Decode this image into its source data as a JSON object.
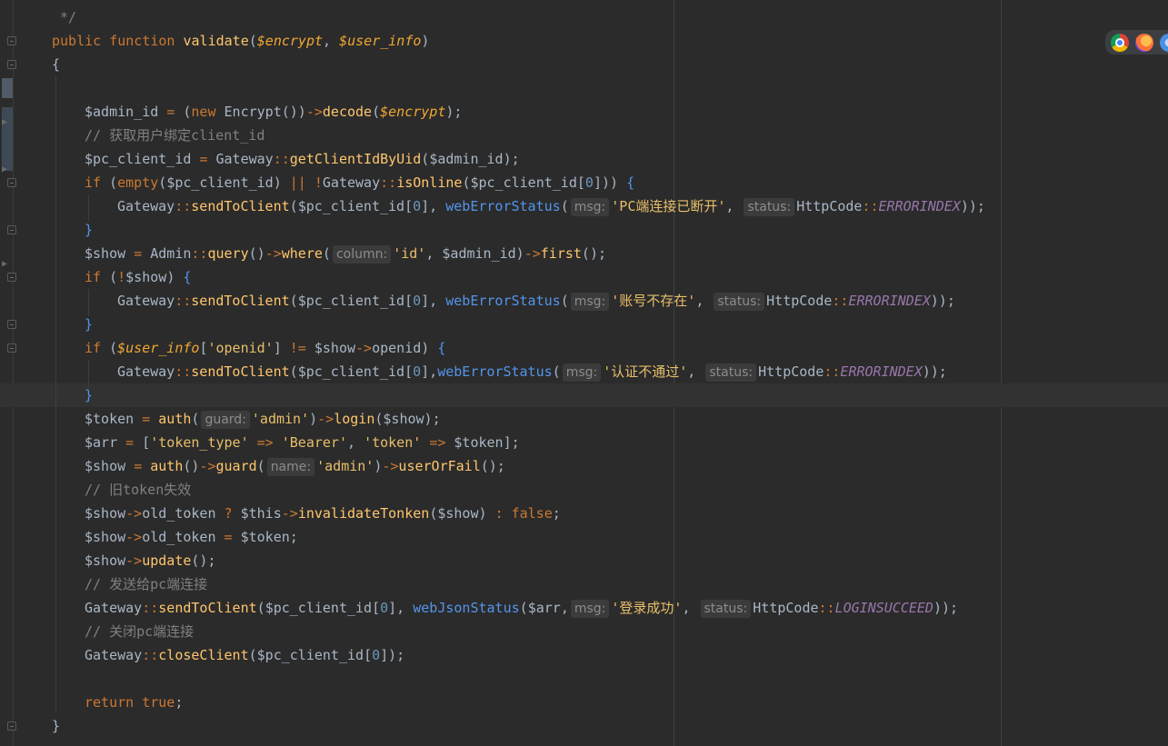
{
  "editor": {
    "lines": [
      {
        "segments": [
          {
            "t": " */",
            "c": "cm"
          }
        ]
      },
      {
        "segments": [
          {
            "t": "public ",
            "c": "kw"
          },
          {
            "t": "function ",
            "c": "kw"
          },
          {
            "t": "validate",
            "c": "fn"
          },
          {
            "t": "(",
            "c": "br"
          },
          {
            "t": "$encrypt",
            "c": "param"
          },
          {
            "t": ", ",
            "c": "br"
          },
          {
            "t": "$user_info",
            "c": "param"
          },
          {
            "t": ")",
            "c": "br"
          }
        ]
      },
      {
        "segments": [
          {
            "t": "{",
            "c": "br"
          }
        ]
      },
      {
        "segments": []
      },
      {
        "segments": [
          {
            "t": "$admin_id ",
            "c": "var"
          },
          {
            "t": "= ",
            "c": "op"
          },
          {
            "t": "(",
            "c": "br"
          },
          {
            "t": "new ",
            "c": "kw"
          },
          {
            "t": "Encrypt",
            "c": "var"
          },
          {
            "t": "())",
            "c": "br"
          },
          {
            "t": "->",
            "c": "op"
          },
          {
            "t": "decode",
            "c": "mcall"
          },
          {
            "t": "(",
            "c": "br"
          },
          {
            "t": "$encrypt",
            "c": "param"
          },
          {
            "t": ");",
            "c": "br"
          }
        ]
      },
      {
        "segments": [
          {
            "t": "// 获取用户绑定client_id",
            "c": "cm"
          }
        ]
      },
      {
        "segments": [
          {
            "t": "$pc_client_id ",
            "c": "var"
          },
          {
            "t": "= ",
            "c": "op"
          },
          {
            "t": "Gateway",
            "c": "var"
          },
          {
            "t": "::",
            "c": "op"
          },
          {
            "t": "getClientIdByUid",
            "c": "mcall"
          },
          {
            "t": "(",
            "c": "br"
          },
          {
            "t": "$admin_id",
            "c": "var"
          },
          {
            "t": ");",
            "c": "br"
          }
        ]
      },
      {
        "segments": [
          {
            "t": "if ",
            "c": "kw"
          },
          {
            "t": "(",
            "c": "br"
          },
          {
            "t": "empty",
            "c": "kw"
          },
          {
            "t": "(",
            "c": "br"
          },
          {
            "t": "$pc_client_id",
            "c": "var"
          },
          {
            "t": ") ",
            "c": "br"
          },
          {
            "t": "|| ",
            "c": "op"
          },
          {
            "t": "!",
            "c": "op"
          },
          {
            "t": "Gateway",
            "c": "var"
          },
          {
            "t": "::",
            "c": "op"
          },
          {
            "t": "isOnline",
            "c": "mcall"
          },
          {
            "t": "(",
            "c": "br"
          },
          {
            "t": "$pc_client_id",
            "c": "var"
          },
          {
            "t": "[",
            "c": "br"
          },
          {
            "t": "0",
            "c": "num"
          },
          {
            "t": "])) ",
            "c": "br"
          },
          {
            "t": "{",
            "c": "br-b"
          }
        ]
      },
      {
        "segments": [
          {
            "t": "Gateway",
            "c": "var"
          },
          {
            "t": "::",
            "c": "op"
          },
          {
            "t": "sendToClient",
            "c": "mcall"
          },
          {
            "t": "(",
            "c": "br"
          },
          {
            "t": "$pc_client_id",
            "c": "var"
          },
          {
            "t": "[",
            "c": "br"
          },
          {
            "t": "0",
            "c": "num"
          },
          {
            "t": "], ",
            "c": "br"
          },
          {
            "t": "webErrorStatus",
            "c": "br-b"
          },
          {
            "t": "(",
            "c": "br"
          },
          {
            "h": "msg:"
          },
          {
            "t": "'PC端连接已断开'",
            "c": "str2"
          },
          {
            "t": ", ",
            "c": "br"
          },
          {
            "h": "status:"
          },
          {
            "t": "HttpCode",
            "c": "var"
          },
          {
            "t": "::",
            "c": "op"
          },
          {
            "t": "ERRORINDEX",
            "c": "const"
          },
          {
            "t": "));",
            "c": "br"
          }
        ]
      },
      {
        "segments": [
          {
            "t": "}",
            "c": "br-b"
          }
        ]
      },
      {
        "segments": [
          {
            "t": "$show ",
            "c": "var"
          },
          {
            "t": "= ",
            "c": "op"
          },
          {
            "t": "Admin",
            "c": "var"
          },
          {
            "t": "::",
            "c": "op"
          },
          {
            "t": "query",
            "c": "mcall"
          },
          {
            "t": "()",
            "c": "br"
          },
          {
            "t": "->",
            "c": "op"
          },
          {
            "t": "where",
            "c": "mcall"
          },
          {
            "t": "(",
            "c": "br"
          },
          {
            "h": "column:"
          },
          {
            "t": "'id'",
            "c": "str2"
          },
          {
            "t": ", ",
            "c": "br"
          },
          {
            "t": "$admin_id",
            "c": "var"
          },
          {
            "t": ")",
            "c": "br"
          },
          {
            "t": "->",
            "c": "op"
          },
          {
            "t": "first",
            "c": "mcall"
          },
          {
            "t": "();",
            "c": "br"
          }
        ]
      },
      {
        "segments": [
          {
            "t": "if ",
            "c": "kw"
          },
          {
            "t": "(",
            "c": "br"
          },
          {
            "t": "!",
            "c": "op"
          },
          {
            "t": "$show",
            "c": "var"
          },
          {
            "t": ") ",
            "c": "br"
          },
          {
            "t": "{",
            "c": "br-b"
          }
        ]
      },
      {
        "segments": [
          {
            "t": "Gateway",
            "c": "var"
          },
          {
            "t": "::",
            "c": "op"
          },
          {
            "t": "sendToClient",
            "c": "mcall"
          },
          {
            "t": "(",
            "c": "br"
          },
          {
            "t": "$pc_client_id",
            "c": "var"
          },
          {
            "t": "[",
            "c": "br"
          },
          {
            "t": "0",
            "c": "num"
          },
          {
            "t": "], ",
            "c": "br"
          },
          {
            "t": "webErrorStatus",
            "c": "br-b"
          },
          {
            "t": "(",
            "c": "br"
          },
          {
            "h": "msg:"
          },
          {
            "t": "'账号不存在'",
            "c": "str2"
          },
          {
            "t": ", ",
            "c": "br"
          },
          {
            "h": "status:"
          },
          {
            "t": "HttpCode",
            "c": "var"
          },
          {
            "t": "::",
            "c": "op"
          },
          {
            "t": "ERRORINDEX",
            "c": "const"
          },
          {
            "t": "));",
            "c": "br"
          }
        ]
      },
      {
        "segments": [
          {
            "t": "}",
            "c": "br-b"
          }
        ]
      },
      {
        "segments": [
          {
            "t": "if ",
            "c": "kw"
          },
          {
            "t": "(",
            "c": "br"
          },
          {
            "t": "$user_info",
            "c": "param"
          },
          {
            "t": "[",
            "c": "br"
          },
          {
            "t": "'openid'",
            "c": "str2"
          },
          {
            "t": "] ",
            "c": "br"
          },
          {
            "t": "!= ",
            "c": "op"
          },
          {
            "t": "$show",
            "c": "var"
          },
          {
            "t": "->",
            "c": "op"
          },
          {
            "t": "openid",
            "c": "var"
          },
          {
            "t": ") ",
            "c": "br"
          },
          {
            "t": "{",
            "c": "br-b"
          }
        ]
      },
      {
        "segments": [
          {
            "t": "Gateway",
            "c": "var"
          },
          {
            "t": "::",
            "c": "op"
          },
          {
            "t": "sendToClient",
            "c": "mcall"
          },
          {
            "t": "(",
            "c": "br"
          },
          {
            "t": "$pc_client_id",
            "c": "var"
          },
          {
            "t": "[",
            "c": "br"
          },
          {
            "t": "0",
            "c": "num"
          },
          {
            "t": "],",
            "c": "br"
          },
          {
            "t": "webErrorStatus",
            "c": "br-b"
          },
          {
            "t": "(",
            "c": "br"
          },
          {
            "h": "msg:"
          },
          {
            "t": "'认证不通过'",
            "c": "str2"
          },
          {
            "t": ", ",
            "c": "br"
          },
          {
            "h": "status:"
          },
          {
            "t": "HttpCode",
            "c": "var"
          },
          {
            "t": "::",
            "c": "op"
          },
          {
            "t": "ERRORINDEX",
            "c": "const"
          },
          {
            "t": "));",
            "c": "br"
          }
        ]
      },
      {
        "segments": [
          {
            "t": "}",
            "c": "br-b"
          }
        ]
      },
      {
        "segments": [
          {
            "t": "$token ",
            "c": "var"
          },
          {
            "t": "= ",
            "c": "op"
          },
          {
            "t": "auth",
            "c": "mcall"
          },
          {
            "t": "(",
            "c": "br"
          },
          {
            "h": "guard:"
          },
          {
            "t": "'admin'",
            "c": "str2"
          },
          {
            "t": ")",
            "c": "br"
          },
          {
            "t": "->",
            "c": "op"
          },
          {
            "t": "login",
            "c": "mcall"
          },
          {
            "t": "(",
            "c": "br"
          },
          {
            "t": "$show",
            "c": "var"
          },
          {
            "t": ");",
            "c": "br"
          }
        ]
      },
      {
        "segments": [
          {
            "t": "$arr ",
            "c": "var"
          },
          {
            "t": "= ",
            "c": "op"
          },
          {
            "t": "[",
            "c": "br"
          },
          {
            "t": "'token_type' ",
            "c": "str2"
          },
          {
            "t": "=> ",
            "c": "op"
          },
          {
            "t": "'Bearer'",
            "c": "str2"
          },
          {
            "t": ", ",
            "c": "br"
          },
          {
            "t": "'token' ",
            "c": "str2"
          },
          {
            "t": "=> ",
            "c": "op"
          },
          {
            "t": "$token",
            "c": "var"
          },
          {
            "t": "];",
            "c": "br"
          }
        ]
      },
      {
        "segments": [
          {
            "t": "$show ",
            "c": "var"
          },
          {
            "t": "= ",
            "c": "op"
          },
          {
            "t": "auth",
            "c": "mcall"
          },
          {
            "t": "()",
            "c": "br"
          },
          {
            "t": "->",
            "c": "op"
          },
          {
            "t": "guard",
            "c": "mcall"
          },
          {
            "t": "(",
            "c": "br"
          },
          {
            "h": "name:"
          },
          {
            "t": "'admin'",
            "c": "str2"
          },
          {
            "t": ")",
            "c": "br"
          },
          {
            "t": "->",
            "c": "op"
          },
          {
            "t": "userOrFail",
            "c": "mcall"
          },
          {
            "t": "();",
            "c": "br"
          }
        ]
      },
      {
        "segments": [
          {
            "t": "// 旧token失效",
            "c": "cm"
          }
        ]
      },
      {
        "segments": [
          {
            "t": "$show",
            "c": "var"
          },
          {
            "t": "->",
            "c": "op"
          },
          {
            "t": "old_token ",
            "c": "var"
          },
          {
            "t": "? ",
            "c": "op"
          },
          {
            "t": "$this",
            "c": "var"
          },
          {
            "t": "->",
            "c": "op"
          },
          {
            "t": "invalidateTonken",
            "c": "mcall"
          },
          {
            "t": "(",
            "c": "br"
          },
          {
            "t": "$show",
            "c": "var"
          },
          {
            "t": ") ",
            "c": "br"
          },
          {
            "t": ": ",
            "c": "op"
          },
          {
            "t": "false",
            "c": "kw"
          },
          {
            "t": ";",
            "c": "br"
          }
        ]
      },
      {
        "segments": [
          {
            "t": "$show",
            "c": "var"
          },
          {
            "t": "->",
            "c": "op"
          },
          {
            "t": "old_token ",
            "c": "var"
          },
          {
            "t": "= ",
            "c": "op"
          },
          {
            "t": "$token",
            "c": "var"
          },
          {
            "t": ";",
            "c": "br"
          }
        ]
      },
      {
        "segments": [
          {
            "t": "$show",
            "c": "var"
          },
          {
            "t": "->",
            "c": "op"
          },
          {
            "t": "update",
            "c": "mcall"
          },
          {
            "t": "();",
            "c": "br"
          }
        ]
      },
      {
        "segments": [
          {
            "t": "// 发送给pc端连接",
            "c": "cm"
          }
        ]
      },
      {
        "segments": [
          {
            "t": "Gateway",
            "c": "var"
          },
          {
            "t": "::",
            "c": "op"
          },
          {
            "t": "sendToClient",
            "c": "mcall"
          },
          {
            "t": "(",
            "c": "br"
          },
          {
            "t": "$pc_client_id",
            "c": "var"
          },
          {
            "t": "[",
            "c": "br"
          },
          {
            "t": "0",
            "c": "num"
          },
          {
            "t": "], ",
            "c": "br"
          },
          {
            "t": "webJsonStatus",
            "c": "br-b"
          },
          {
            "t": "(",
            "c": "br"
          },
          {
            "t": "$arr",
            "c": "var"
          },
          {
            "t": ",",
            "c": "br"
          },
          {
            "h": "msg:"
          },
          {
            "t": "'登录成功'",
            "c": "str2"
          },
          {
            "t": ", ",
            "c": "br"
          },
          {
            "h": "status:"
          },
          {
            "t": "HttpCode",
            "c": "var"
          },
          {
            "t": "::",
            "c": "op"
          },
          {
            "t": "LOGINSUCCEED",
            "c": "const"
          },
          {
            "t": "));",
            "c": "br"
          }
        ]
      },
      {
        "segments": [
          {
            "t": "// 关闭pc端连接",
            "c": "cm"
          }
        ]
      },
      {
        "segments": [
          {
            "t": "Gateway",
            "c": "var"
          },
          {
            "t": "::",
            "c": "op"
          },
          {
            "t": "closeClient",
            "c": "mcall"
          },
          {
            "t": "(",
            "c": "br"
          },
          {
            "t": "$pc_client_id",
            "c": "var"
          },
          {
            "t": "[",
            "c": "br"
          },
          {
            "t": "0",
            "c": "num"
          },
          {
            "t": "]);",
            "c": "br"
          }
        ]
      },
      {
        "segments": []
      },
      {
        "segments": [
          {
            "t": "return ",
            "c": "kw"
          },
          {
            "t": "true",
            "c": "kw"
          },
          {
            "t": ";",
            "c": "br"
          }
        ]
      },
      {
        "segments": [
          {
            "t": "}",
            "c": "br"
          }
        ]
      }
    ]
  },
  "browser_icons": [
    "chrome-icon",
    "firefox-icon",
    "edge-icon"
  ],
  "colors": {
    "background": "#2b2b2b",
    "current_line": "#323232",
    "keyword": "#cc7832",
    "function": "#ffc66d",
    "string": "#e8bf6a",
    "comment": "#808080",
    "constant": "#9876aa",
    "number": "#6897bb"
  }
}
